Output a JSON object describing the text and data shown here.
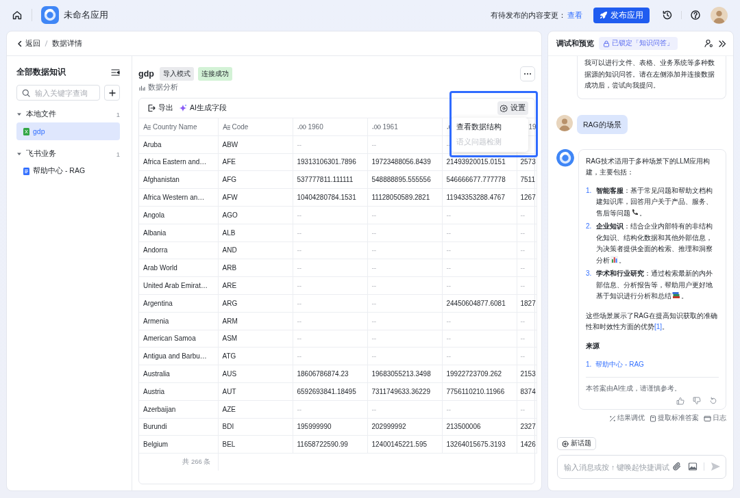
{
  "top_bar": {
    "app_name": "未命名应用",
    "pending_label": "有待发布的内容变更：",
    "pending_link": "查看",
    "publish_button": "发布应用"
  },
  "breadcrumb": {
    "back": "返回",
    "current": "数据详情"
  },
  "sidebar": {
    "title": "全部数据知识",
    "search": {
      "placeholder": "输入关键字查询"
    },
    "groups": [
      {
        "label": "本地文件",
        "count": "1",
        "expanded": true,
        "children": [
          {
            "label": "gdp",
            "kind": "excel",
            "selected": true
          }
        ]
      },
      {
        "label": "飞书业务",
        "count": "1",
        "expanded": true,
        "children": [
          {
            "label": "帮助中心 - RAG",
            "kind": "doc",
            "selected": false
          }
        ]
      }
    ]
  },
  "dataset": {
    "name": "gdp",
    "tags": [
      {
        "label": "导入模式",
        "color": "#e9eaed"
      },
      {
        "label": "连接成功",
        "color": "#d3f2d6"
      }
    ],
    "analysis_link": "数据分析"
  },
  "toolbar": {
    "export": "导出",
    "ai_fields": "AI生成字段",
    "settings": "设置"
  },
  "settings_menu": {
    "highlighted": true,
    "items": [
      {
        "label": "查看数据结构",
        "disabled": false
      },
      {
        "label": "语义问题检测",
        "disabled": true
      }
    ]
  },
  "table": {
    "columns": [
      {
        "kind": "text",
        "label": "Country Name"
      },
      {
        "kind": "text",
        "label": "Code"
      },
      {
        "kind": "number",
        "label": "1960"
      },
      {
        "kind": "number",
        "label": "1961"
      },
      {
        "kind": "number"
      },
      {
        "label": "19"
      }
    ],
    "rows": [
      [
        "Aruba",
        "ABW",
        "--",
        "--",
        "--",
        null
      ],
      [
        "Africa Eastern and…",
        "AFE",
        "19313106301.7896",
        "19723488056.8439",
        "21493920015.0151",
        "2573"
      ],
      [
        "Afghanistan",
        "AFG",
        "537777811.111111",
        "548888895.555556",
        "546666677.777778",
        "7511"
      ],
      [
        "Africa Western an…",
        "AFW",
        "10404280784.1531",
        "11128050589.2821",
        "11943353288.4767",
        "1267"
      ],
      [
        "Angola",
        "AGO",
        "--",
        "--",
        "--",
        "--"
      ],
      [
        "Albania",
        "ALB",
        "--",
        "--",
        "--",
        "--"
      ],
      [
        "Andorra",
        "AND",
        "--",
        "--",
        "--",
        "--"
      ],
      [
        "Arab World",
        "ARB",
        "--",
        "--",
        "--",
        "--"
      ],
      [
        "United Arab Emirat…",
        "ARE",
        "--",
        "--",
        "--",
        "--"
      ],
      [
        "Argentina",
        "ARG",
        "--",
        "--",
        "24450604877.6081",
        "1827"
      ],
      [
        "Armenia",
        "ARM",
        "--",
        "--",
        "--",
        "--"
      ],
      [
        "American Samoa",
        "ASM",
        "--",
        "--",
        "--",
        "--"
      ],
      [
        "Antigua and Barbu…",
        "ATG",
        "--",
        "--",
        "--",
        "--"
      ],
      [
        "Australia",
        "AUS",
        "18606786874.23",
        "19683055213.3498",
        "19922723709.262",
        "2153"
      ],
      [
        "Austria",
        "AUT",
        "6592693841.18495",
        "7311749633.36229",
        "7756110210.11966",
        "8374"
      ],
      [
        "Azerbaijan",
        "AZE",
        "--",
        "--",
        "--",
        "--"
      ],
      [
        "Burundi",
        "BDI",
        "195999990",
        "202999992",
        "213500006",
        "2327"
      ],
      [
        "Belgium",
        "BEL",
        "11658722590.99",
        "12400145221.595",
        "13264015675.3193",
        "1426"
      ]
    ],
    "footer": "共 266 条"
  },
  "preview": {
    "title": "调试和预览",
    "lock_badge": "已锁定「知识问答」",
    "messages": [
      {
        "kind": "bot_intro",
        "text": "我可以进行文件、表格、业务系统等多种数据源的知识问答。请在左侧添加并连接数据成功后，尝试向我提问。"
      },
      {
        "kind": "user",
        "text": "RAG的场景"
      },
      {
        "kind": "bot_answer",
        "intro": "RAG技术适用于多种场景下的LLM应用构建，主要包括：",
        "items": [
          {
            "number": "1.",
            "text": "**智能客服**：基于常见问题和帮助文档构建知识库，回答用户关于产品、服务、售后等问题",
            "kind": "phone",
            "tail": "。"
          },
          {
            "number": "2.",
            "text": "**企业知识**：结合企业内部特有的非结构化知识、结构化数据和其他外部信息，为决策者提供全面的检索、推理和洞察分析",
            "kind": "chart",
            "tail": "。"
          },
          {
            "number": "3.",
            "text": "**学术和行业研究**：通过检索最新的内外部信息、分析报告等，帮助用户更好地基于知识进行分析和总结",
            "kind": "books",
            "tail": "。"
          }
        ],
        "summary": "这些场景展示了RAG在提高知识获取的准确性和时效性方面的优势",
        "citation": "[1]",
        "summary_tail": "。",
        "sources_title": "来源",
        "sources": [
          {
            "number": "1.",
            "label": "帮助中心 - RAG"
          }
        ],
        "disclaimer": "本答案由AI生成，请谨慎参考。"
      }
    ],
    "actions": [
      {
        "kind": "tune",
        "label": "结果调优"
      },
      {
        "kind": "extract",
        "label": "提取标准答案"
      },
      {
        "kind": "log",
        "label": "日志"
      }
    ],
    "new_topic": "新话题",
    "input": {
      "placeholder": "输入消息或按 ↑ 键唤起快捷调试"
    }
  }
}
